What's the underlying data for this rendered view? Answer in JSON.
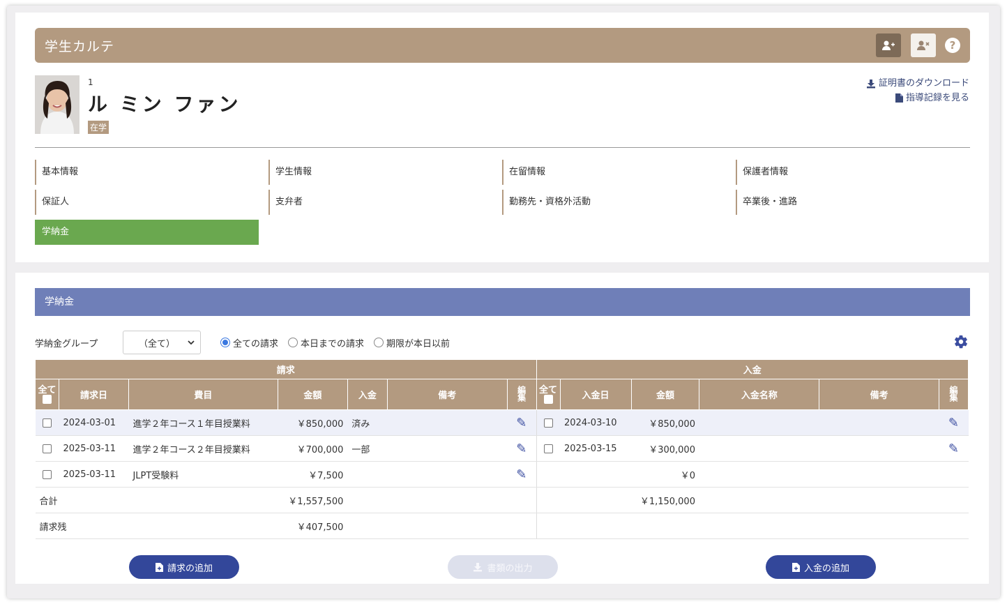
{
  "karte": {
    "title": "学生カルテ",
    "buttons": {
      "add_user": "person-add-icon",
      "remove_user": "person-remove-icon",
      "help": "?"
    }
  },
  "student": {
    "number": "1",
    "name": "ル ミン ファン",
    "status": "在学"
  },
  "links": {
    "download_certificate": "証明書のダウンロード",
    "view_guidance": "指導記録を見る"
  },
  "nav": {
    "items": [
      {
        "label": "基本情報"
      },
      {
        "label": "学生情報"
      },
      {
        "label": "在留情報"
      },
      {
        "label": "保護者情報"
      },
      {
        "label": "保証人"
      },
      {
        "label": "支弁者"
      },
      {
        "label": "勤務先・資格外活動"
      },
      {
        "label": "卒業後・進路"
      },
      {
        "label": "学納金"
      }
    ],
    "active": "学納金"
  },
  "fees": {
    "title": "学納金",
    "group_label": "学納金グループ",
    "group_value": "（全て）",
    "radios": [
      {
        "label": "全ての請求",
        "selected": true
      },
      {
        "label": "本日までの請求",
        "selected": false
      },
      {
        "label": "期限が本日以前",
        "selected": false
      }
    ],
    "billing_header": "請求",
    "payment_header": "入金",
    "billing_columns": {
      "all": "全て",
      "date": "請求日",
      "item": "費目",
      "amount": "金額",
      "paid": "入金",
      "note": "備考",
      "edit": "編集"
    },
    "payment_columns": {
      "all": "全て",
      "date": "入金日",
      "amount": "金額",
      "name": "入金名称",
      "note": "備考",
      "edit": "編集"
    },
    "rows": [
      {
        "bill_date": "2024-03-01",
        "item": "進学２年コース１年目授業料",
        "amount": "￥850,000",
        "paid": "済み",
        "note": "",
        "pay_date": "2024-03-10",
        "pay_amount": "￥850,000",
        "pay_name": "",
        "pay_note": ""
      },
      {
        "bill_date": "2025-03-11",
        "item": "進学２年コース２年目授業料",
        "amount": "￥700,000",
        "paid": "一部",
        "note": "",
        "pay_date": "2025-03-15",
        "pay_amount": "￥300,000",
        "pay_name": "",
        "pay_note": ""
      },
      {
        "bill_date": "2025-03-11",
        "item": "JLPT受験料",
        "amount": "￥7,500",
        "paid": "",
        "note": "",
        "pay_date": "",
        "pay_amount": "￥0",
        "pay_name": "",
        "pay_note": ""
      }
    ],
    "total_label": "合計",
    "total_billed": "￥1,557,500",
    "total_paid": "￥1,150,000",
    "balance_label": "請求残",
    "balance": "￥407,500",
    "buttons": {
      "add_bill": "請求の追加",
      "export_docs": "書類の出力",
      "add_payment": "入金の追加"
    }
  },
  "colors": {
    "brown_header": "#b39a80",
    "blue_header": "#6f7fb8",
    "active_nav": "#6aa84f",
    "primary_button": "#33479a"
  }
}
